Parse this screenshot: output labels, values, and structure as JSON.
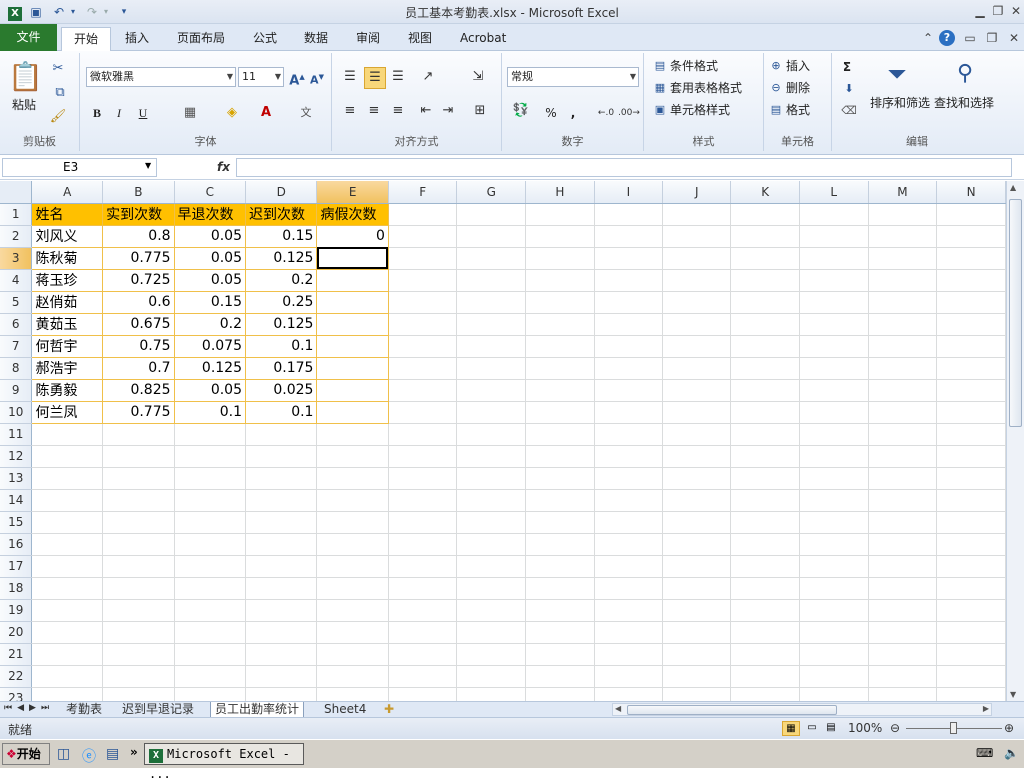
{
  "window": {
    "title": "员工基本考勤表.xlsx  -  Microsoft Excel"
  },
  "quick_access": {
    "save_icon": "save-icon",
    "undo_icon": "undo-icon",
    "redo_icon": "redo-icon"
  },
  "tabs": [
    "文件",
    "开始",
    "插入",
    "页面布局",
    "公式",
    "数据",
    "审阅",
    "视图",
    "Acrobat"
  ],
  "ribbon": {
    "clipboard": {
      "paste": "粘贴",
      "label": "剪贴板"
    },
    "font": {
      "name": "微软雅黑",
      "size": "11",
      "label": "字体",
      "bold": "B",
      "italic": "I",
      "underline": "U"
    },
    "alignment": {
      "label": "对齐方式"
    },
    "number": {
      "format": "常规",
      "label": "数字",
      "percent": "%",
      "comma": ","
    },
    "styles": {
      "conditional": "条件格式",
      "table": "套用表格格式",
      "cell": "单元格样式",
      "label": "样式"
    },
    "cells": {
      "insert": "插入",
      "delete": "删除",
      "format": "格式",
      "label": "单元格"
    },
    "editing": {
      "sort": "排序和筛选",
      "find": "查找和选择",
      "label": "编辑",
      "sum": "Σ"
    }
  },
  "formula_bar": {
    "name_box": "E3",
    "fx": "fx",
    "value": ""
  },
  "sheet": {
    "columns": [
      "A",
      "B",
      "C",
      "D",
      "E",
      "F",
      "G",
      "H",
      "I",
      "J",
      "K",
      "L",
      "M",
      "N"
    ],
    "rows": [
      "1",
      "2",
      "3",
      "4",
      "5",
      "6",
      "7",
      "8",
      "9",
      "10",
      "11",
      "12",
      "13",
      "14",
      "15",
      "16",
      "17",
      "18",
      "19",
      "20",
      "21",
      "22",
      "23"
    ],
    "header": [
      "姓名",
      "实到次数",
      "早退次数",
      "迟到次数",
      "病假次数"
    ],
    "data": [
      [
        "刘风义",
        "0.8",
        "0.05",
        "0.15",
        "0"
      ],
      [
        "陈秋菊",
        "0.775",
        "0.05",
        "0.125",
        ""
      ],
      [
        "蒋玉珍",
        "0.725",
        "0.05",
        "0.2",
        ""
      ],
      [
        "赵俏茹",
        "0.6",
        "0.15",
        "0.25",
        ""
      ],
      [
        "黄茹玉",
        "0.675",
        "0.2",
        "0.125",
        ""
      ],
      [
        "何哲宇",
        "0.75",
        "0.075",
        "0.1",
        ""
      ],
      [
        "郝浩宇",
        "0.7",
        "0.125",
        "0.175",
        ""
      ],
      [
        "陈勇毅",
        "0.825",
        "0.05",
        "0.025",
        ""
      ],
      [
        "何兰凤",
        "0.775",
        "0.1",
        "0.1",
        ""
      ]
    ]
  },
  "sheet_tabs": [
    "考勤表",
    "迟到早退记录",
    "员工出勤率统计",
    "Sheet4"
  ],
  "active_sheet_tab": "员工出勤率统计",
  "status": {
    "ready": "就绪",
    "zoom": "100%"
  },
  "taskbar": {
    "start": "开始",
    "task": "Microsoft Excel - ..."
  }
}
